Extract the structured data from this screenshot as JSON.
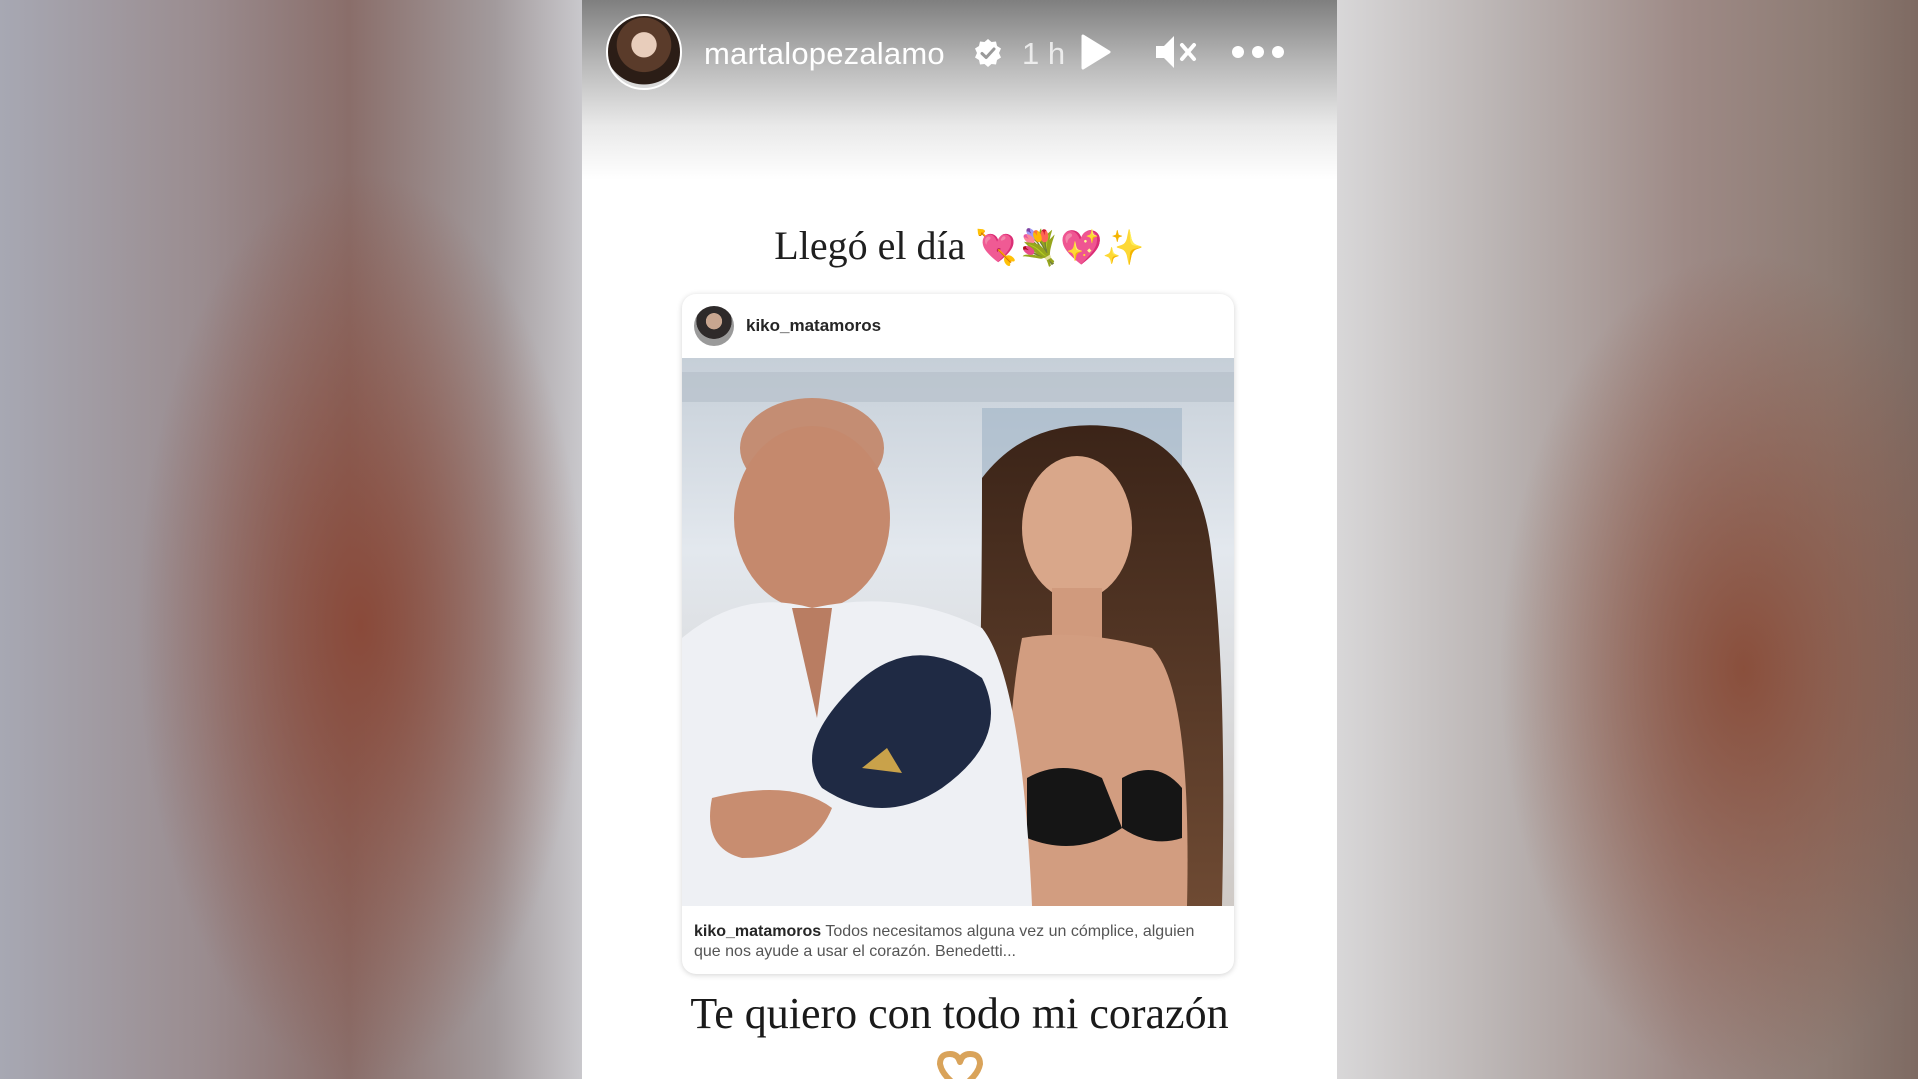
{
  "story": {
    "username": "martalopezalamo",
    "time": "1 h",
    "headline": "Llegó el día",
    "headline_emojis": "💘💐💖✨",
    "bottom_text": "Te quiero con todo mi corazón"
  },
  "post": {
    "username": "kiko_matamoros",
    "caption_user": "kiko_matamoros",
    "caption_text": "Todos necesitamos alguna vez un cómplice, alguien que nos ayude a usar el corazón. Benedetti..."
  },
  "icons": {
    "verified": "verified-badge-icon",
    "play": "play-icon",
    "mute": "mute-icon",
    "more": "more-icon",
    "heart_hands": "heart-hands-icon"
  },
  "colors": {
    "text_white": "#ffffff",
    "text_dark": "#1f1f1f"
  }
}
